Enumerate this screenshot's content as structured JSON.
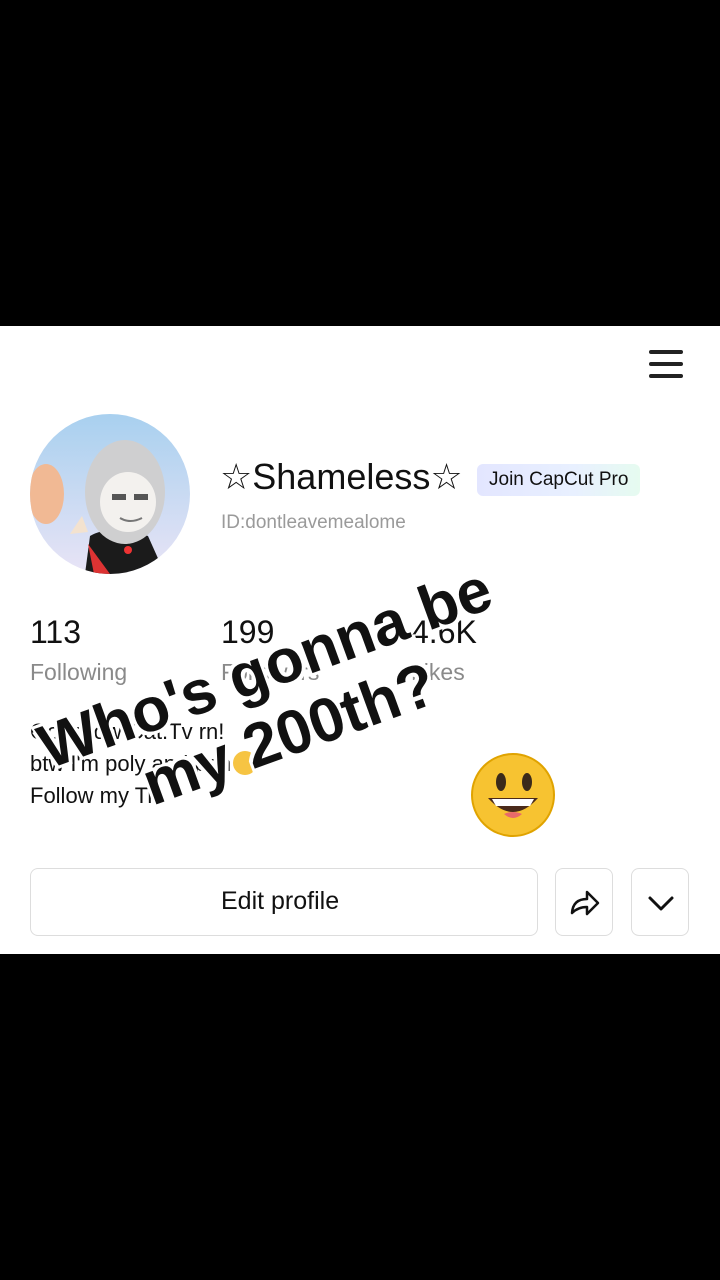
{
  "profile": {
    "name": "☆Shameless☆",
    "pro_badge": "Join CapCut Pro",
    "id_text": "ID:dontleavemealome"
  },
  "stats": [
    {
      "value": "113",
      "label": "Following"
    },
    {
      "value": "199",
      "label": "Followers"
    },
    {
      "value": "4.6K",
      "label": "Likes"
    }
  ],
  "bio": {
    "line1": "Go follow Cat.Tv rn!",
    "line2": "btw I'm poly and pan",
    "line3": "Follow my Tik"
  },
  "actions": {
    "edit_profile": "Edit profile"
  },
  "overlay": {
    "line1": "Who's gonna be",
    "line2": "my 200th?"
  },
  "icons": {
    "menu": "hamburger-menu-icon",
    "share": "share-arrow-icon",
    "more": "chevron-down-icon",
    "emoji": "grinning-face-emoji"
  }
}
